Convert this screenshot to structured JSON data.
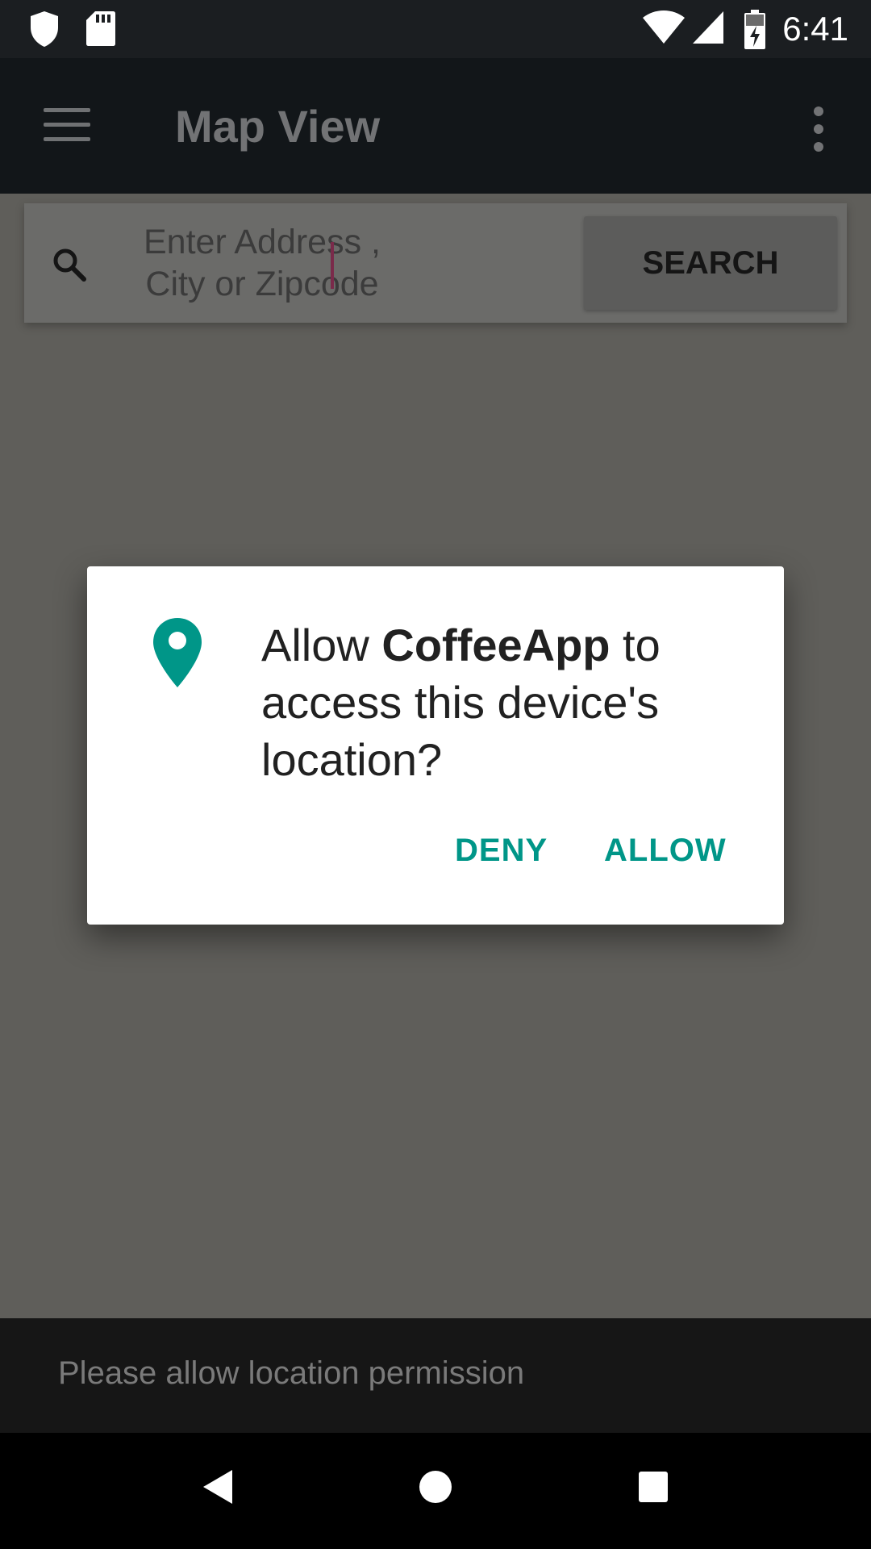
{
  "status_bar": {
    "time": "6:41",
    "icons": [
      "shield-icon",
      "sd-card-icon",
      "wifi-icon",
      "signal-icon",
      "battery-charging-icon"
    ]
  },
  "app_bar": {
    "title": "Map View",
    "icons": [
      "menu-icon",
      "more-vert-icon"
    ]
  },
  "search": {
    "placeholder": "Enter Address , City or Zipcode",
    "button_label": "SEARCH",
    "icon": "search-icon"
  },
  "dialog": {
    "prefix": "Allow ",
    "app_name": "CoffeeApp",
    "suffix": " to access this device's location?",
    "icon": "location-pin-icon",
    "accent_color": "#009688",
    "deny_label": "DENY",
    "allow_label": "ALLOW"
  },
  "snackbar": {
    "message": "Please allow location permission"
  },
  "nav_bar": {
    "icons": [
      "back-icon",
      "home-icon",
      "recents-icon"
    ]
  }
}
